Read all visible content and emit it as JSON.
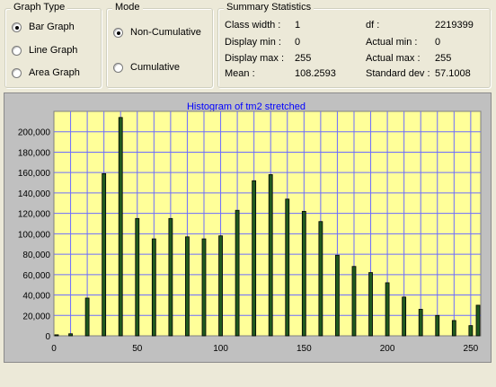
{
  "graph_type": {
    "title": "Graph Type",
    "options": [
      {
        "label": "Bar Graph",
        "selected": true
      },
      {
        "label": "Line Graph",
        "selected": false
      },
      {
        "label": "Area Graph",
        "selected": false
      }
    ]
  },
  "mode": {
    "title": "Mode",
    "options": [
      {
        "label": "Non-Cumulative",
        "selected": true
      },
      {
        "label": "Cumulative",
        "selected": false
      }
    ]
  },
  "summary": {
    "title": "Summary Statistics",
    "class_width_label": "Class width :",
    "class_width": "1",
    "display_min_label": "Display min :",
    "display_min": "0",
    "display_max_label": "Display max :",
    "display_max": "255",
    "mean_label": "Mean :",
    "mean": "108.2593",
    "df_label": "df :",
    "df": "2219399",
    "actual_min_label": "Actual min :",
    "actual_min": "0",
    "actual_max_label": "Actual max :",
    "actual_max": "255",
    "std_label": "Standard dev :",
    "std": "57.1008"
  },
  "colors": {
    "plot_background": "#ffff99",
    "grid": "#6d6dff",
    "bar_fill": "#1f5a1f",
    "bar_edge": "#000000",
    "title_text": "#0000ff"
  },
  "chart_data": {
    "type": "bar",
    "title": "Histogram of tm2 stretched",
    "xlabel": "",
    "ylabel": "",
    "xlim": [
      0,
      256
    ],
    "ylim": [
      0,
      220000
    ],
    "x_ticks": [
      "0",
      "50",
      "100",
      "150",
      "200",
      "250"
    ],
    "y_ticks": [
      "0",
      "20,000",
      "40,000",
      "60,000",
      "80,000",
      "100,000",
      "120,000",
      "140,000",
      "160,000",
      "180,000",
      "200,000"
    ],
    "grid": true,
    "x": [
      0,
      10,
      20,
      30,
      40,
      50,
      60,
      70,
      80,
      90,
      100,
      110,
      120,
      130,
      140,
      150,
      160,
      170,
      180,
      190,
      200,
      210,
      220,
      230,
      240,
      250,
      255
    ],
    "values": [
      1000,
      2000,
      37000,
      159000,
      214000,
      115000,
      95000,
      115000,
      97000,
      95000,
      98000,
      123000,
      152000,
      158000,
      134000,
      122000,
      112000,
      79000,
      68000,
      62000,
      52000,
      38000,
      26000,
      20000,
      15000,
      10000,
      30000
    ]
  }
}
